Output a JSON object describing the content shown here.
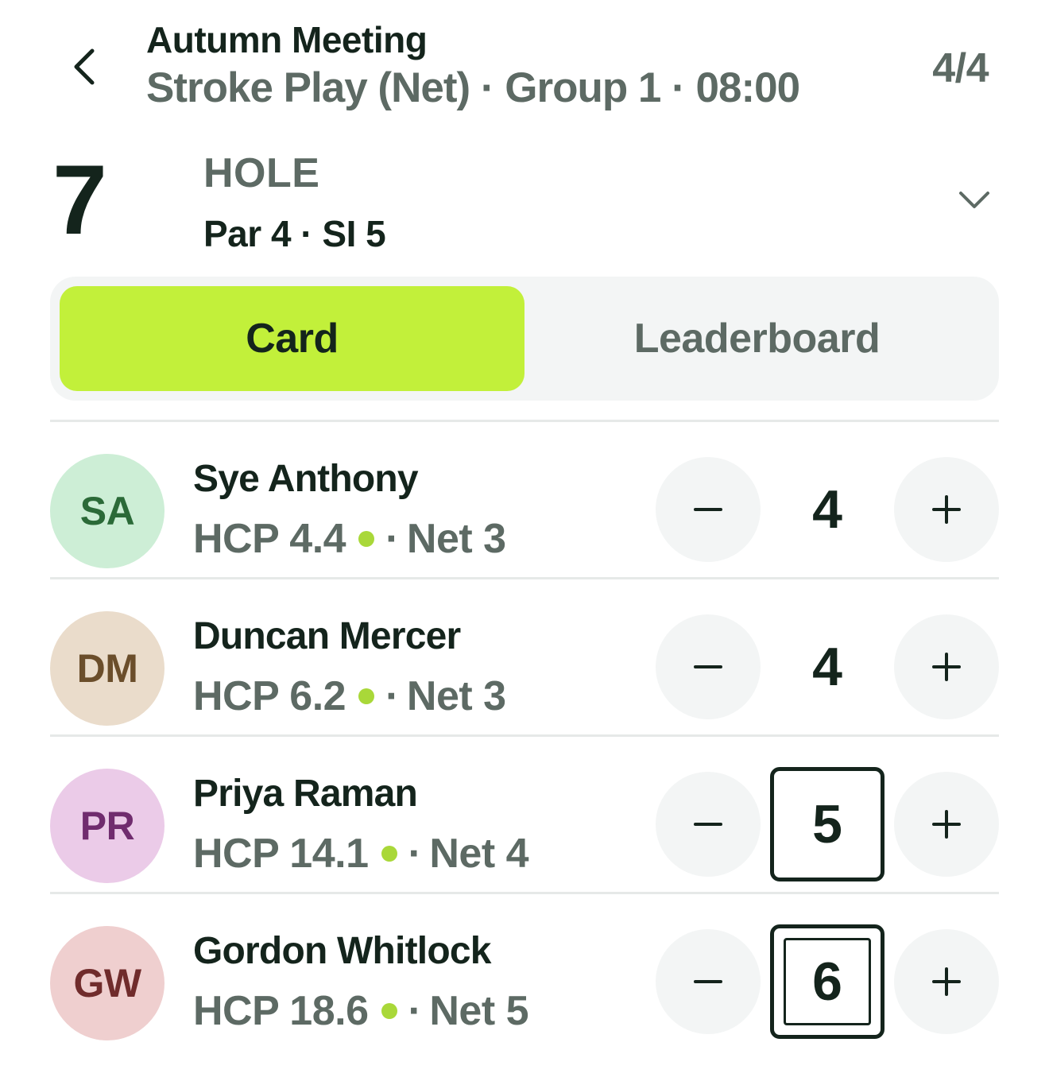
{
  "header": {
    "event_title": "Autumn Meeting",
    "event_subtitle": "Stroke Play (Net) · Group 1 · 08:00",
    "page_count": "4/4"
  },
  "hole": {
    "number": "7",
    "label": "HOLE",
    "meta": "Par 4 · SI 5"
  },
  "tabs": [
    {
      "label": "Card",
      "active": true
    },
    {
      "label": "Leaderboard",
      "active": false
    }
  ],
  "colors": {
    "accent": "#c2f03a",
    "text_primary": "#14241c",
    "text_secondary": "#5d6a64",
    "stroke_dot": "#a9d839"
  },
  "players": [
    {
      "initials": "SA",
      "name": "Sye Anthony",
      "hcp": "HCP 4.4",
      "net": "Net 3",
      "score": "4",
      "score_style": "plain",
      "avatar_bg": "#cdeed6",
      "avatar_fg": "#2b6a38"
    },
    {
      "initials": "DM",
      "name": "Duncan Mercer",
      "hcp": "HCP 6.2",
      "net": "Net 3",
      "score": "4",
      "score_style": "plain",
      "avatar_bg": "#eadccb",
      "avatar_fg": "#6b4e2b"
    },
    {
      "initials": "PR",
      "name": "Priya Raman",
      "hcp": "HCP 14.1",
      "net": "Net 4",
      "score": "5",
      "score_style": "bogey",
      "avatar_bg": "#ebcbe8",
      "avatar_fg": "#702c6e"
    },
    {
      "initials": "GW",
      "name": "Gordon Whitlock",
      "hcp": "HCP 18.6",
      "net": "Net 5",
      "score": "6",
      "score_style": "double-bogey",
      "avatar_bg": "#efcfcf",
      "avatar_fg": "#702c2c"
    }
  ],
  "controls": {
    "minus_symbol": "−",
    "plus_symbol": "+",
    "separator": "·"
  }
}
